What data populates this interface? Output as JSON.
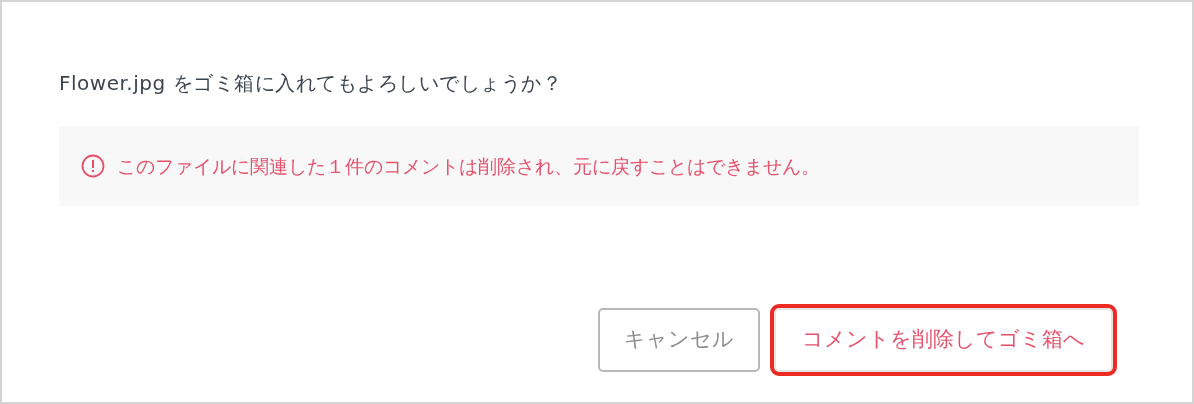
{
  "dialog": {
    "message": "Flower.jpg をゴミ箱に入れてもよろしいでしょうか？",
    "warning": {
      "text": "このファイルに関連した１件のコメントは削除され、元に戻すことはできません。"
    },
    "buttons": [
      {
        "label": "キャンセル",
        "kind": "secondary",
        "highlighted": false
      },
      {
        "label": "コメントを削除してゴミ箱へ",
        "kind": "danger",
        "highlighted": true
      }
    ]
  }
}
